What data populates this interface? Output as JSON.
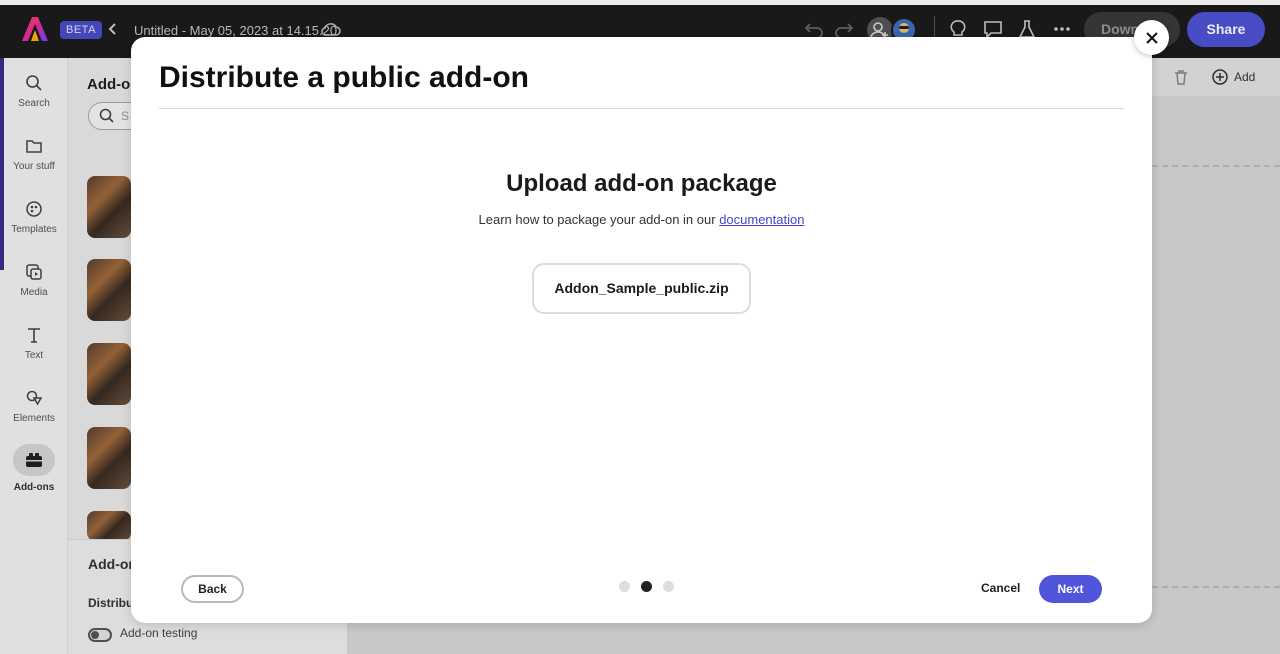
{
  "topbar": {
    "beta_label": "BETA",
    "doc_title": "Untitled - May 05, 2023 at 14.15.20",
    "download_label": "Down",
    "share_label": "Share"
  },
  "rail": {
    "items": [
      {
        "label": "Search",
        "icon": "search-icon"
      },
      {
        "label": "Your stuff",
        "icon": "folder-icon"
      },
      {
        "label": "Templates",
        "icon": "templates-icon"
      },
      {
        "label": "Media",
        "icon": "media-icon"
      },
      {
        "label": "Text",
        "icon": "text-icon"
      },
      {
        "label": "Elements",
        "icon": "elements-icon"
      },
      {
        "label": "Add-ons",
        "icon": "addons-icon"
      }
    ]
  },
  "panel": {
    "title": "Add-o",
    "search_placeholder": "S",
    "footer_heading": "Add-on",
    "footer_section": "Distribut",
    "toggle_label": "Add-on testing"
  },
  "canvas": {
    "add_label": "Add"
  },
  "modal": {
    "title": "Distribute a public add-on",
    "subheading": "Upload add-on package",
    "help_text": "Learn how to package your add-on in our ",
    "help_link": "documentation",
    "file_name": "Addon_Sample_public.zip",
    "back_label": "Back",
    "cancel_label": "Cancel",
    "next_label": "Next",
    "step_current": 2,
    "step_total": 3
  },
  "colors": {
    "accent": "#5155dc",
    "topbar_bg": "#1c1c1c",
    "link": "#4646c8"
  }
}
